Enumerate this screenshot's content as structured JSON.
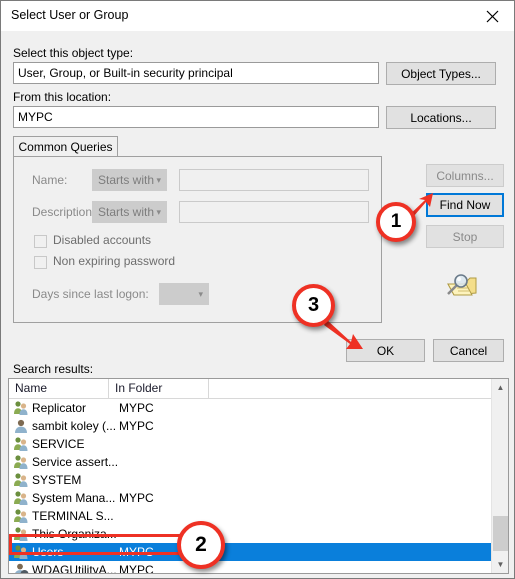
{
  "window": {
    "title": "Select User or Group",
    "close_icon": "close-icon"
  },
  "object_type": {
    "label": "Select this object type:",
    "value": "User, Group, or Built-in security principal",
    "button": "Object Types..."
  },
  "location": {
    "label": "From this location:",
    "value": "MYPC",
    "button": "Locations..."
  },
  "tabs": [
    {
      "label": "Common Queries",
      "active": true
    }
  ],
  "query": {
    "name_label": "Name:",
    "name_operator": "Starts with",
    "name_value": "",
    "description_label": "Description:",
    "description_operator": "Starts with",
    "description_value": "",
    "disabled_accounts_label": "Disabled accounts",
    "disabled_accounts_checked": false,
    "non_expiring_password_label": "Non expiring password",
    "non_expiring_password_checked": false,
    "days_since_logon_label": "Days since last logon:",
    "days_since_logon_value": ""
  },
  "side_buttons": {
    "columns": "Columns...",
    "find_now": "Find Now",
    "stop": "Stop"
  },
  "finder_icon": "folder-search-icon",
  "dialog_buttons": {
    "ok": "OK",
    "cancel": "Cancel"
  },
  "results": {
    "label": "Search results:",
    "columns": [
      "Name",
      "In Folder"
    ],
    "rows": [
      {
        "name": "Replicator",
        "folder": "MYPC",
        "icon": "group-icon",
        "selected": false
      },
      {
        "name": "sambit koley (...",
        "folder": "MYPC",
        "icon": "user-icon",
        "selected": false
      },
      {
        "name": "SERVICE",
        "folder": "",
        "icon": "group-icon",
        "selected": false
      },
      {
        "name": "Service assert...",
        "folder": "",
        "icon": "group-icon",
        "selected": false
      },
      {
        "name": "SYSTEM",
        "folder": "",
        "icon": "group-icon",
        "selected": false
      },
      {
        "name": "System Mana...",
        "folder": "MYPC",
        "icon": "group-icon",
        "selected": false
      },
      {
        "name": "TERMINAL S...",
        "folder": "",
        "icon": "group-icon",
        "selected": false
      },
      {
        "name": "This Organiza...",
        "folder": "",
        "icon": "group-icon",
        "selected": false
      },
      {
        "name": "Users",
        "folder": "MYPC",
        "icon": "group-icon",
        "selected": true
      },
      {
        "name": "WDAGUtilityA...",
        "folder": "MYPC",
        "icon": "user-down-icon",
        "selected": false
      }
    ],
    "scrollbar": {
      "up_icon": "chevron-up-icon",
      "down_icon": "chevron-down-icon"
    }
  },
  "annotations": [
    {
      "number": "1",
      "target": "find-now-button"
    },
    {
      "number": "2",
      "target": "results-row-users"
    },
    {
      "number": "3",
      "target": "ok-button"
    }
  ],
  "colors": {
    "accent_blue": "#0078d7",
    "selection_blue": "#0a7fdb",
    "annotation_red": "#ee3124",
    "dialog_bg": "#f0f0f0"
  }
}
